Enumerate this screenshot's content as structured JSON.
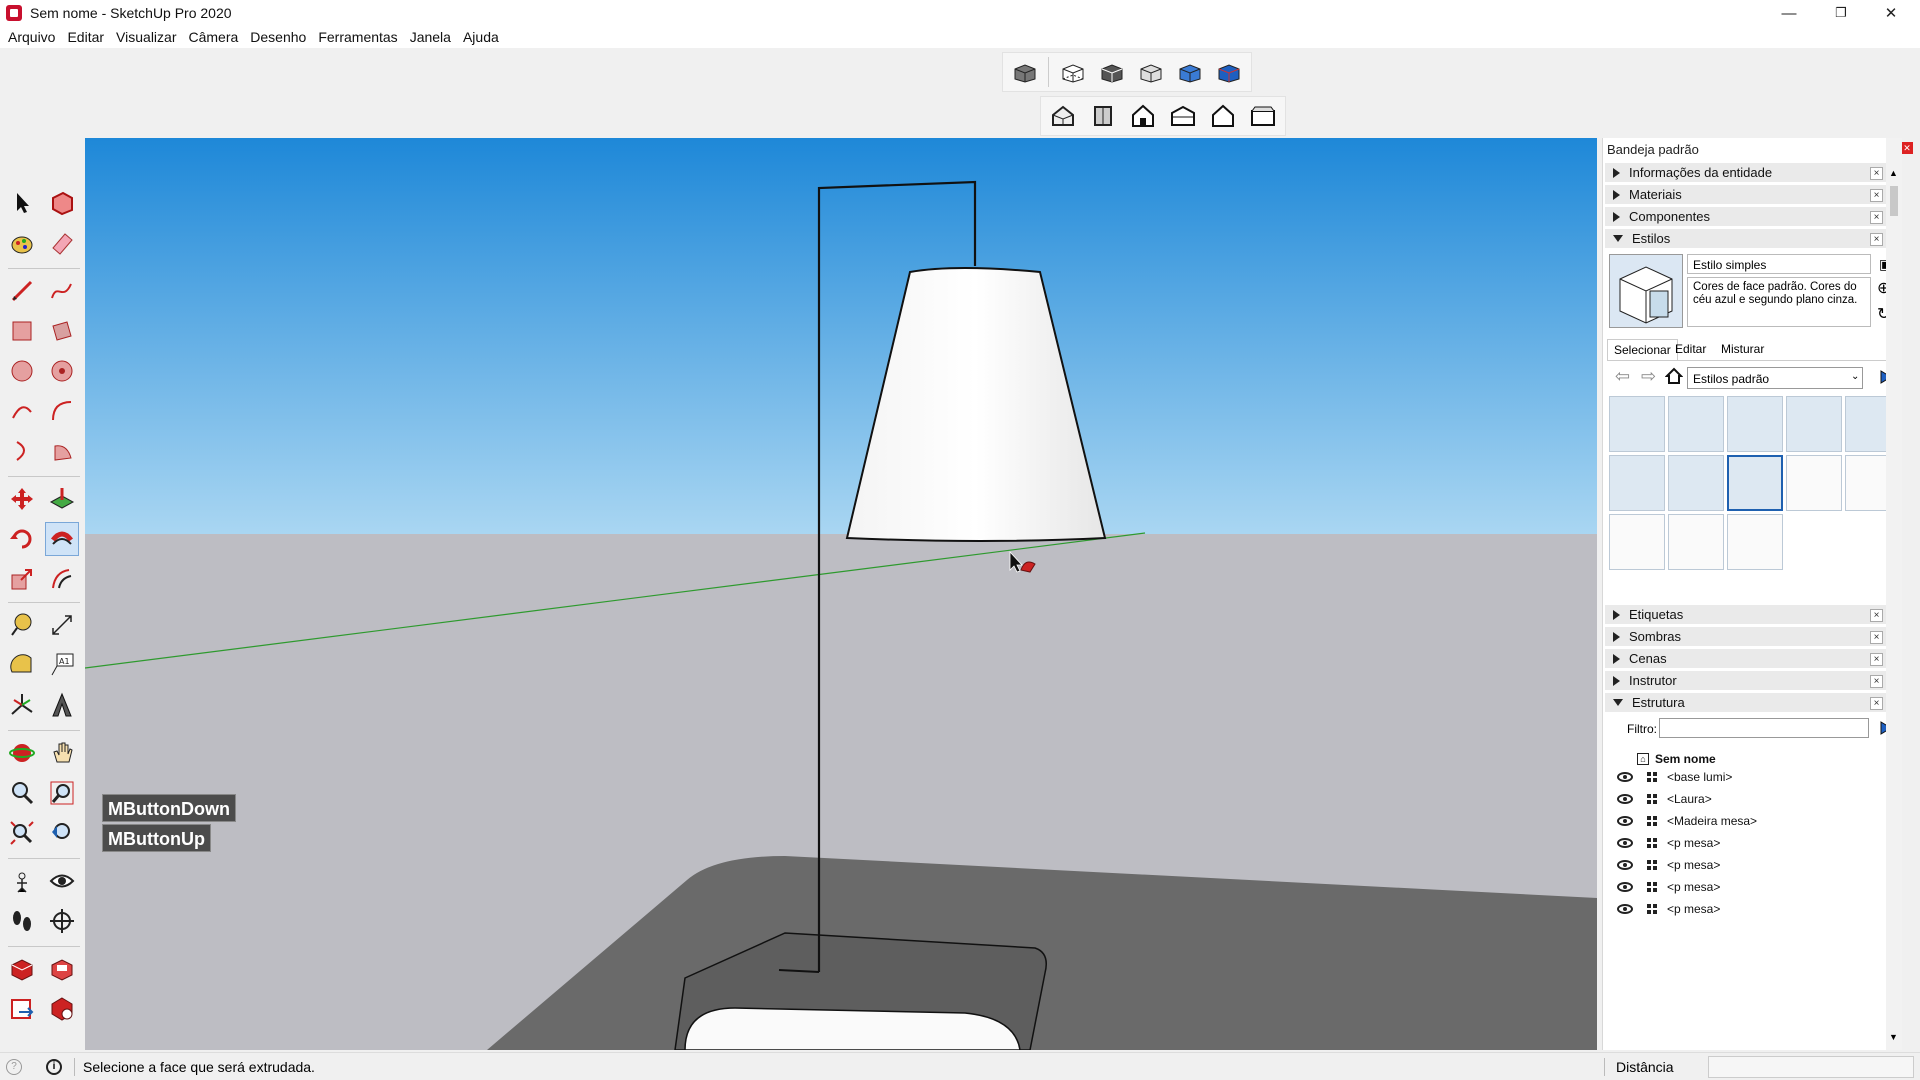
{
  "window": {
    "title": "Sem nome - SketchUp Pro 2020",
    "minimize": "—",
    "maximize": "❐",
    "close": "✕"
  },
  "menu": [
    "Arquivo",
    "Editar",
    "Visualizar",
    "Câmera",
    "Desenho",
    "Ferramentas",
    "Janela",
    "Ajuda"
  ],
  "toolbars": {
    "view_styles": [
      "xray-icon",
      "back-edges-icon",
      "wireframe-icon",
      "hidden-line-icon",
      "shaded-icon",
      "shaded-textures-icon"
    ],
    "standard_views": [
      "iso-view-icon",
      "top-view-icon",
      "front-view-icon",
      "right-view-icon",
      "back-view-icon",
      "left-view-icon"
    ]
  },
  "overlay": {
    "line1": "MButtonDown",
    "line2": "MButtonUp"
  },
  "tray": {
    "title": "Bandeja padrão",
    "pin": "⊓",
    "close": "✕",
    "sections_top": [
      "Informações da entidade",
      "Materiais",
      "Componentes",
      "Estilos"
    ],
    "styles": {
      "name": "Estilo simples",
      "description": "Cores de face padrão. Cores do céu azul e segundo plano cinza.",
      "tabs": [
        "Selecionar",
        "Editar",
        "Misturar"
      ],
      "collection": "Estilos padrão"
    },
    "sections_bottom": [
      "Etiquetas",
      "Sombras",
      "Cenas",
      "Instrutor",
      "Estrutura"
    ],
    "outliner": {
      "filter_label": "Filtro:",
      "filter_value": "",
      "root": "Sem nome",
      "items": [
        "<base lumi>",
        "<Laura>",
        "<Madeira mesa>",
        "<p mesa>",
        "<p mesa>",
        "<p mesa>",
        "<p mesa>"
      ]
    }
  },
  "status": {
    "message": "Selecione a face que será extrudada.",
    "distance_label": "Distância",
    "distance_value": ""
  },
  "colors": {
    "sky_top": "#1e88d8",
    "sky_bottom": "#a9d6f2",
    "ground": "#bdbdc3",
    "table": "#6a6a6a",
    "green_axis": "#2e9a2e"
  }
}
